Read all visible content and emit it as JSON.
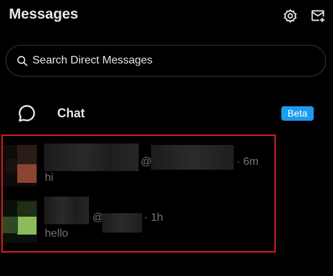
{
  "header": {
    "title": "Messages",
    "settings_icon": "gear-icon",
    "new_message_icon": "envelope-plus-icon"
  },
  "search": {
    "placeholder": "Search Direct Messages",
    "icon": "search-icon"
  },
  "chat": {
    "label": "Chat",
    "badge": "Beta",
    "icon": "chat-bubble-icon"
  },
  "conversations": [
    {
      "handle_prefix": "@",
      "time": "· 6m",
      "last_message": "hi"
    },
    {
      "handle_prefix": "@",
      "time": "· 1h",
      "last_message": "hello"
    }
  ],
  "colors": {
    "background": "#000000",
    "text": "#e7e9ea",
    "secondary_text": "#71767b",
    "accent": "#1d9bf0",
    "highlight_border": "#d2201f"
  }
}
